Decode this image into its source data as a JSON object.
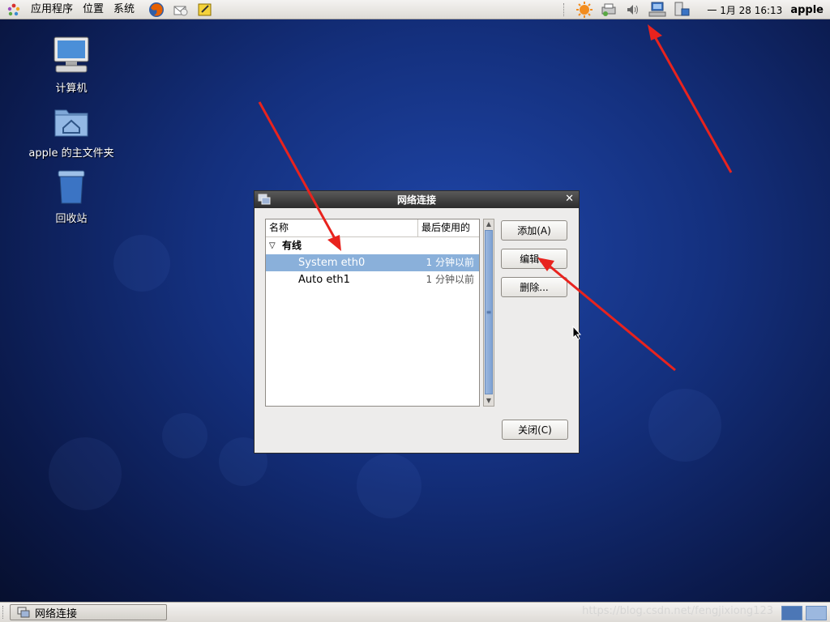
{
  "top_panel": {
    "menus": [
      "应用程序",
      "位置",
      "系统"
    ],
    "clock": "一 1月 28 16:13",
    "user": "apple"
  },
  "desktop": {
    "icons": [
      {
        "label": "计算机",
        "icon": "computer-icon"
      },
      {
        "label": "apple 的主文件夹",
        "icon": "home-folder-icon"
      },
      {
        "label": "回收站",
        "icon": "trash-icon"
      }
    ]
  },
  "dialog": {
    "title": "网络连接",
    "columns": [
      "名称",
      "最后使用的"
    ],
    "group": "有线",
    "connections": [
      {
        "name": "System eth0",
        "last_used": "1 分钟以前",
        "selected": true
      },
      {
        "name": "Auto eth1",
        "last_used": "1 分钟以前",
        "selected": false
      }
    ],
    "buttons": {
      "add": "添加(A)",
      "edit": "编辑...",
      "delete": "删除...",
      "close": "关闭(C)"
    }
  },
  "taskbar": {
    "task": "网络连接"
  },
  "watermark": "https://blog.csdn.net/fengjixiong123",
  "colors": {
    "selection": "#8ab0da",
    "annotation_arrow": "#e8231e"
  }
}
